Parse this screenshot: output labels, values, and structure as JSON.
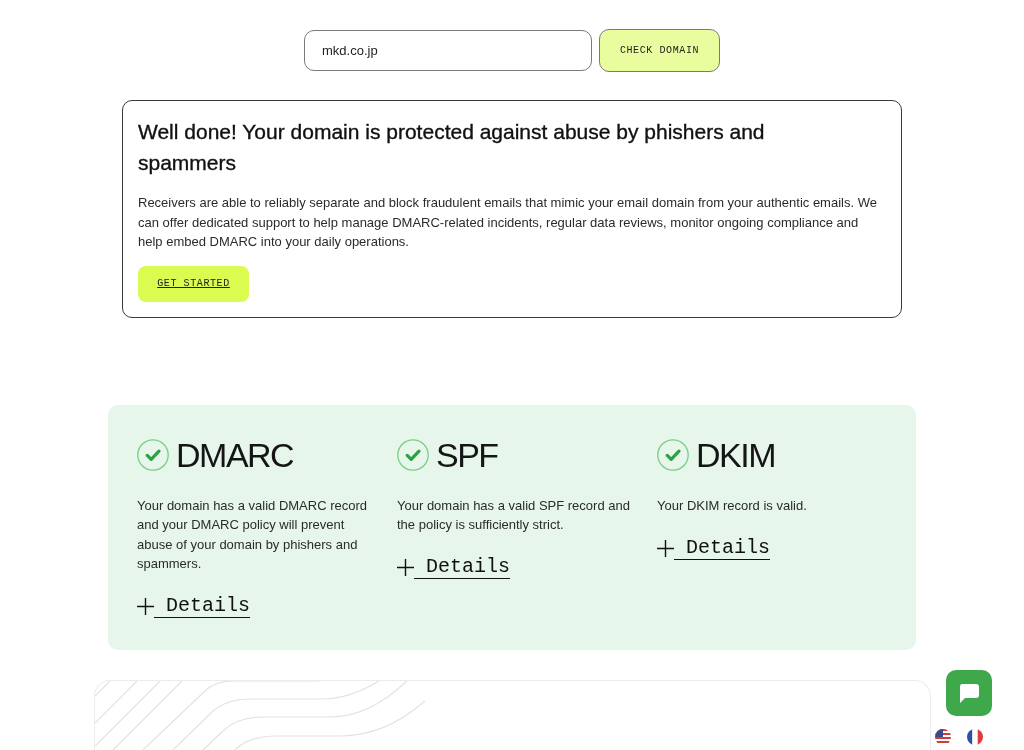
{
  "domain_check": {
    "value": "mkd.co.jp",
    "button": "CHECK DOMAIN"
  },
  "result": {
    "title": "Well done! Your domain is protected against abuse by phishers and spammers",
    "description": "Receivers are able to reliably separate and block fraudulent emails that mimic your email domain from your authentic emails. We can offer dedicated support to help manage DMARC-related incidents, regular data reviews, monitor ongoing compliance and help embed DMARC into your daily operations.",
    "button": "GET STARTED"
  },
  "checks": [
    {
      "name": "DMARC",
      "passed": true,
      "description": "Your domain has a valid DMARC record and your DMARC policy will prevent abuse of your domain by phishers and spammers.",
      "link": "Details"
    },
    {
      "name": "SPF",
      "passed": true,
      "description": "Your domain has a valid SPF record and the policy is sufficiently strict.",
      "link": "Details"
    },
    {
      "name": "DKIM",
      "passed": true,
      "description": "Your DKIM record is valid.",
      "link": "Details"
    }
  ]
}
